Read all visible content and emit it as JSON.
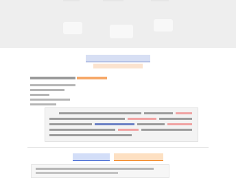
{
  "hero": {
    "tiles": [
      "tile-1",
      "tile-2",
      "tile-3"
    ]
  },
  "sections": {
    "heading": "",
    "subheading": "",
    "lead": "",
    "list_items": [
      "",
      "",
      "",
      "",
      ""
    ],
    "panel_rows": 5,
    "banner_left": "",
    "banner_right": "",
    "notice": ""
  },
  "colors": {
    "heading_fill": "#d7dff4",
    "heading_accent": "#6c82c8",
    "highlight_orange": "#f6a868",
    "highlight_red": "#f0a2a2",
    "banner_left_fill": "#d3def8",
    "banner_right_fill": "#fde0c2"
  }
}
